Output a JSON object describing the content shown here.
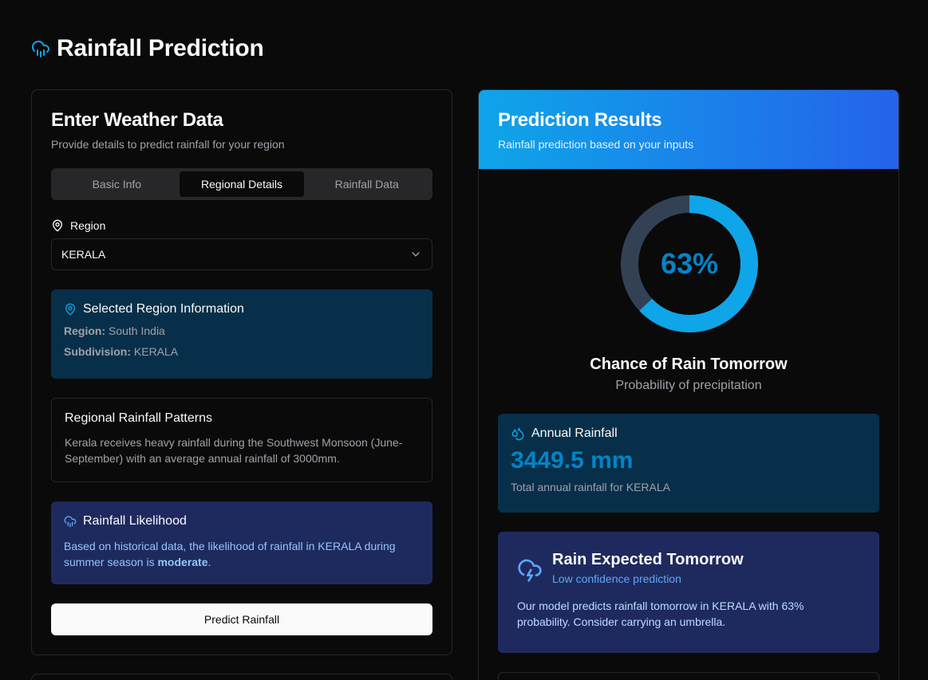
{
  "page": {
    "title": "Rainfall Prediction",
    "title_icon": "cloud-rain-icon",
    "accent": "#0ea5e9"
  },
  "form": {
    "title": "Enter Weather Data",
    "subtitle": "Provide details to predict rainfall for your region",
    "tabs": [
      {
        "label": "Basic Info",
        "active": false
      },
      {
        "label": "Regional Details",
        "active": true
      },
      {
        "label": "Rainfall Data",
        "active": false
      }
    ],
    "region_label": "Region",
    "region_value": "KERALA",
    "region_info": {
      "title": "Selected Region Information",
      "region_key": "Region:",
      "region_val": "South India",
      "subdivision_key": "Subdivision:",
      "subdivision_val": "KERALA"
    },
    "patterns": {
      "title": "Regional Rainfall Patterns",
      "text": "Kerala receives heavy rainfall during the Southwest Monsoon (June-September) with an average annual rainfall of 3000mm."
    },
    "likelihood": {
      "title": "Rainfall Likelihood",
      "text_before": "Based on historical data, the likelihood of rainfall in KERALA during summer season is ",
      "text_bold": "moderate",
      "text_after": "."
    },
    "predict_label": "Predict Rainfall"
  },
  "results": {
    "title": "Prediction Results",
    "subtitle": "Rainfall prediction based on your inputs",
    "probability": 0.63,
    "probability_label": "63%",
    "chance_title": "Chance of Rain Tomorrow",
    "chance_sub": "Probability of precipitation",
    "annual": {
      "title": "Annual Rainfall",
      "value": "3449.5 mm",
      "sub": "Total annual rainfall for KERALA"
    },
    "expected": {
      "title": "Rain Expected Tomorrow",
      "confidence": "Low confidence prediction",
      "text": "Our model predicts rainfall tomorrow in KERALA with 63% probability. Consider carrying an umbrella."
    },
    "colors": {
      "ring_fill": "#0ea5e9",
      "ring_track": "#334155",
      "value": "#0284c7"
    }
  }
}
